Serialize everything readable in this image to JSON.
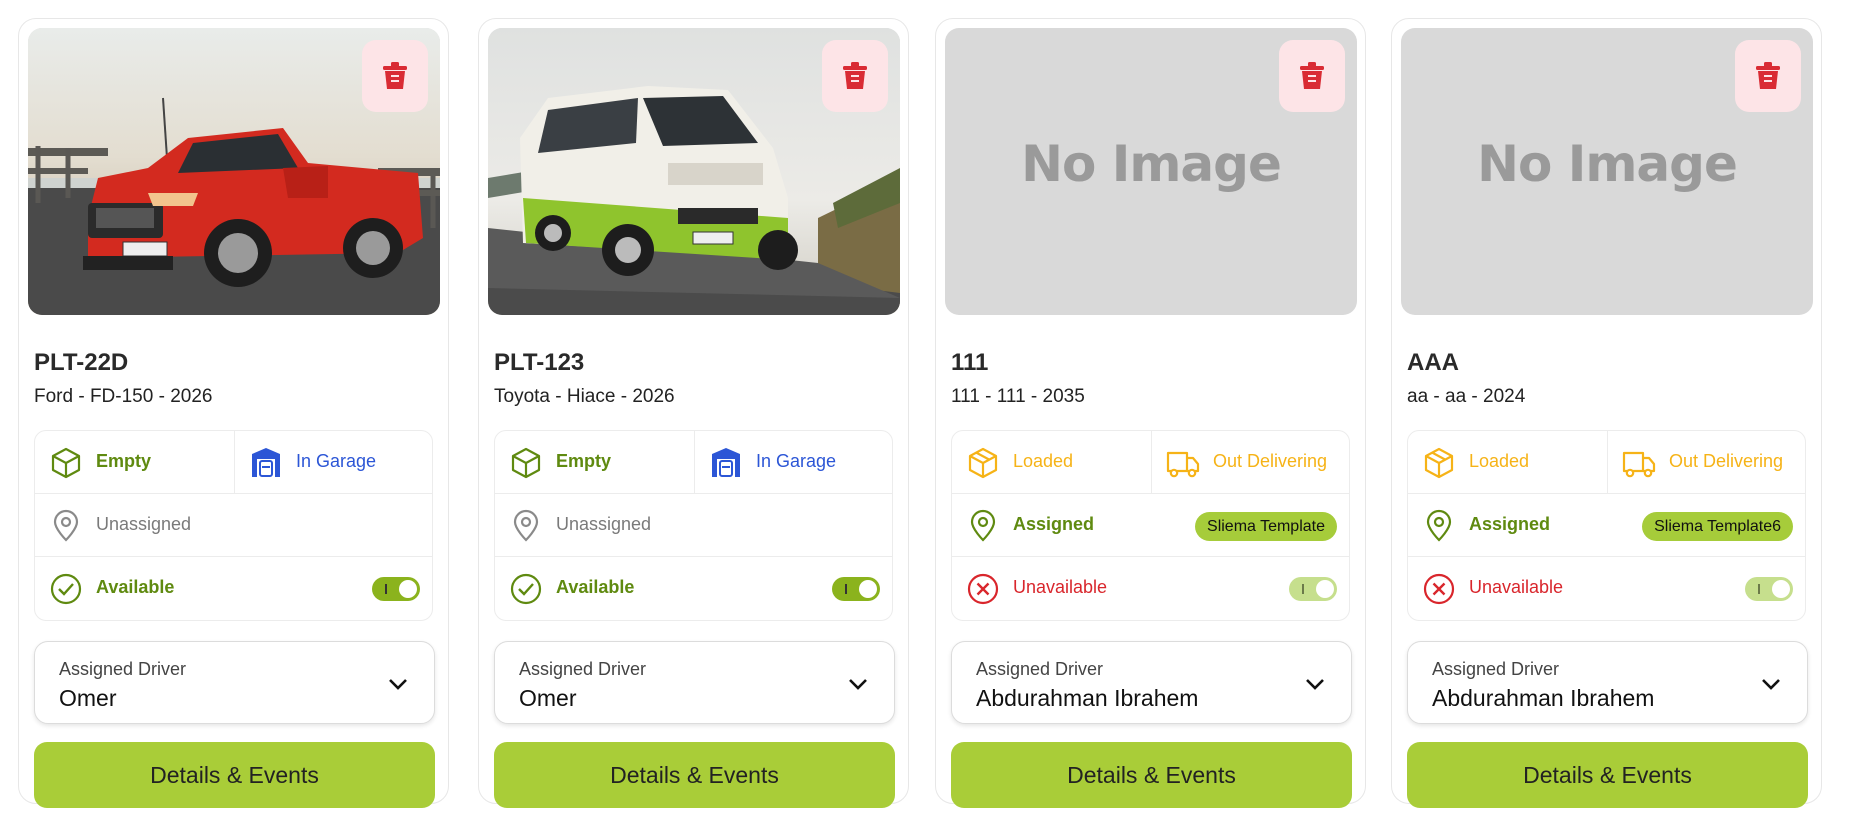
{
  "labels": {
    "assigned_driver": "Assigned Driver",
    "details_button": "Details & Events",
    "delete_icon": "trash-icon"
  },
  "vehicles": [
    {
      "plate": "PLT-22D",
      "subtitle": "Ford - FD-150 - 2026",
      "image": "red pickup truck photo",
      "load_status": "Empty",
      "location_status": "In Garage",
      "assignment_status": "Unassigned",
      "assignment_tag": "",
      "availability": "Available",
      "available_on": true,
      "driver": "Omer"
    },
    {
      "plate": "PLT-123",
      "subtitle": "Toyota - Hiace - 2026",
      "image": "white and green van photo",
      "load_status": "Empty",
      "location_status": "In Garage",
      "assignment_status": "Unassigned",
      "assignment_tag": "",
      "availability": "Available",
      "available_on": true,
      "driver": "Omer"
    },
    {
      "plate": "111",
      "subtitle": "111 - 111 - 2035",
      "image_placeholder": "No Image",
      "load_status": "Loaded",
      "location_status": "Out Delivering",
      "assignment_status": "Assigned",
      "assignment_tag": "Sliema Template",
      "availability": "Unavailable",
      "available_on": false,
      "driver": "Abdurahman Ibrahem"
    },
    {
      "plate": "AAA",
      "subtitle": "aa - aa - 2024",
      "image_placeholder": "No Image",
      "load_status": "Loaded",
      "location_status": "Out Delivering",
      "assignment_status": "Assigned",
      "assignment_tag": "Sliema Template6",
      "availability": "Unavailable",
      "available_on": false,
      "driver": "Abdurahman Ibrahem"
    }
  ],
  "colors": {
    "accent_green": "#a9cd38",
    "status_green": "#5f8a10",
    "status_blue": "#2c56d6",
    "status_orange": "#f6b317",
    "status_red": "#d9262c",
    "delete_bg": "#fde4e7"
  }
}
